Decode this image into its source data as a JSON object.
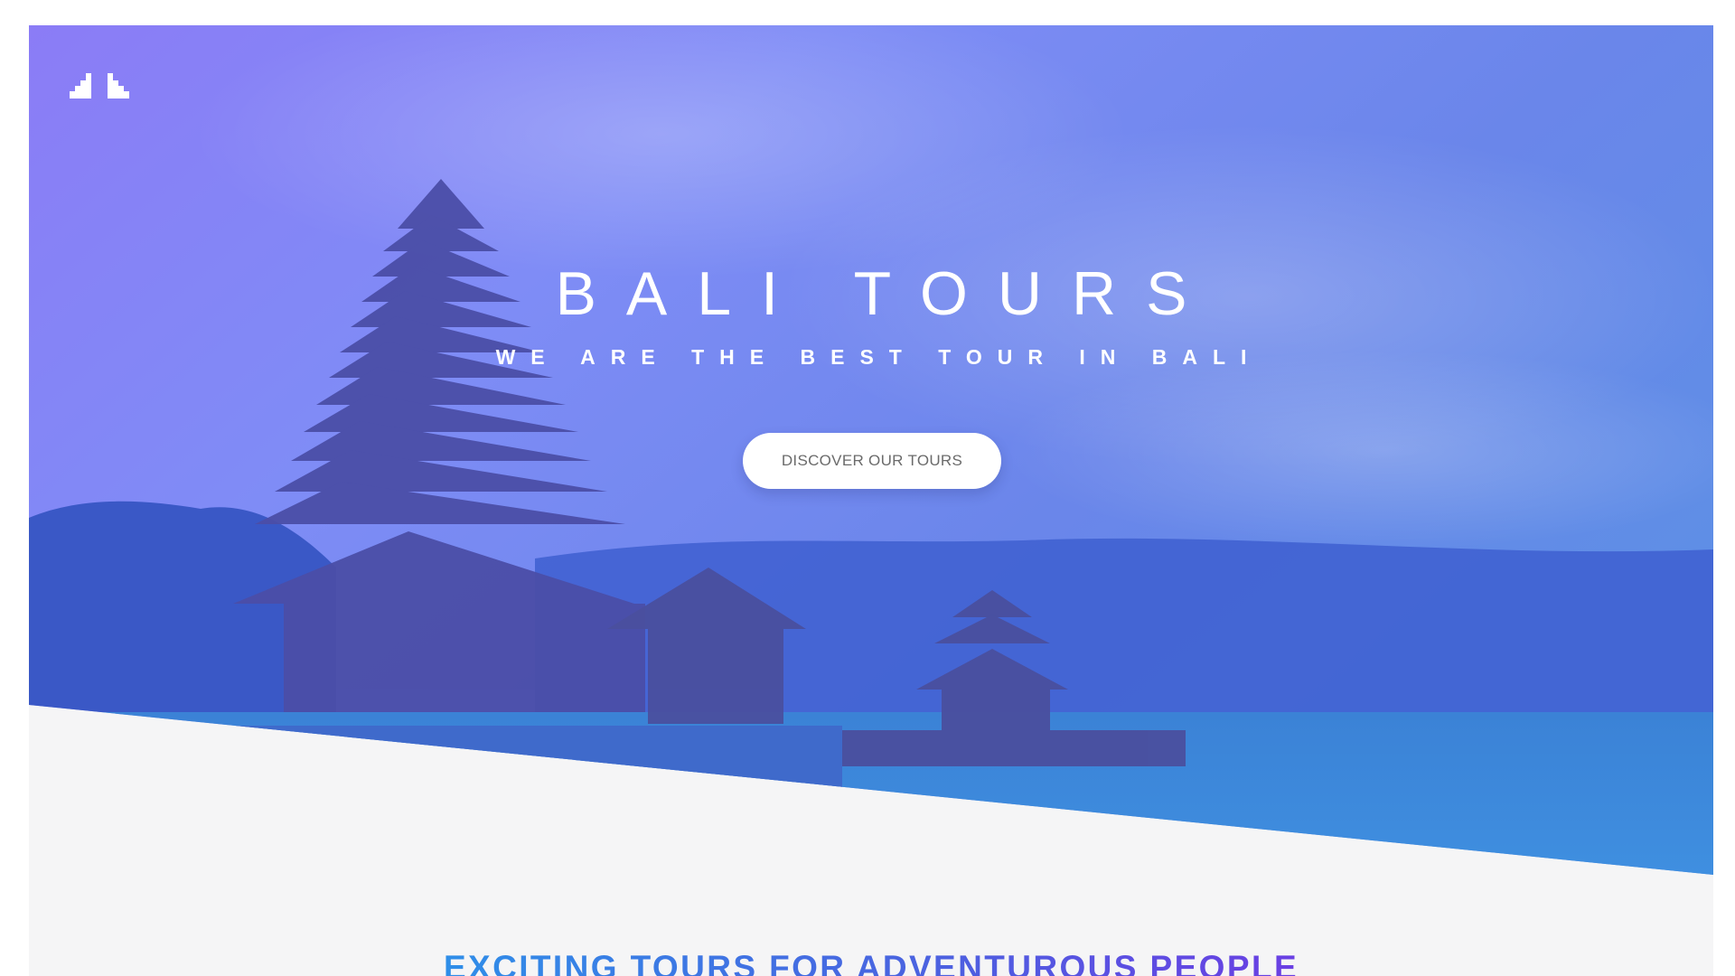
{
  "logo": {
    "icon": "temple-gate-icon",
    "color": "#ffffff"
  },
  "hero": {
    "title": "BALI TOURS",
    "subtitle": "WE ARE THE BEST TOUR IN BALI",
    "cta_label": "DISCOVER OUR TOURS",
    "background": "pagoda-temple-lake-photo",
    "overlay_colors": [
      "#8b7cf6",
      "#5b7fe6",
      "#4f8fde"
    ]
  },
  "section": {
    "heading": "EXCITING TOURS FOR ADVENTUROUS PEOPLE",
    "heading_gradient": [
      "#2f8ee8",
      "#6a3fe3"
    ]
  }
}
